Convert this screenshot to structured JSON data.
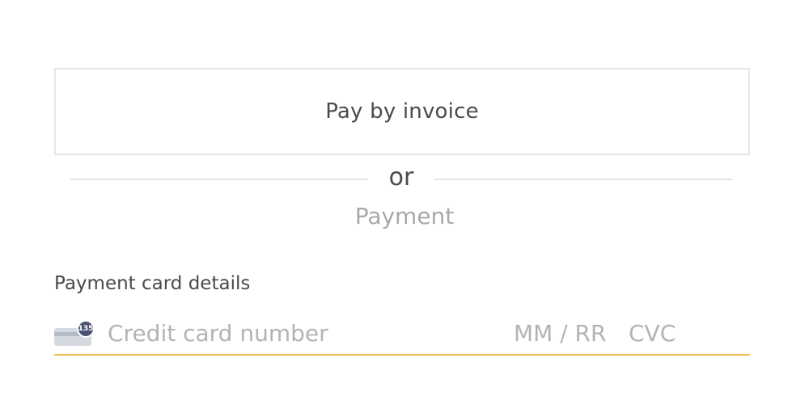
{
  "invoice_button": {
    "label": "Pay by invoice"
  },
  "divider": {
    "text": "or"
  },
  "payment_section": {
    "heading": "Payment"
  },
  "card_form": {
    "label": "Payment card details",
    "card_icon": "credit-card-icon",
    "card_badge": "135",
    "number_placeholder": "Credit card number",
    "expiry_placeholder": "MM / RR",
    "cvc_placeholder": "CVC",
    "focus_color": "#f0b64a"
  }
}
